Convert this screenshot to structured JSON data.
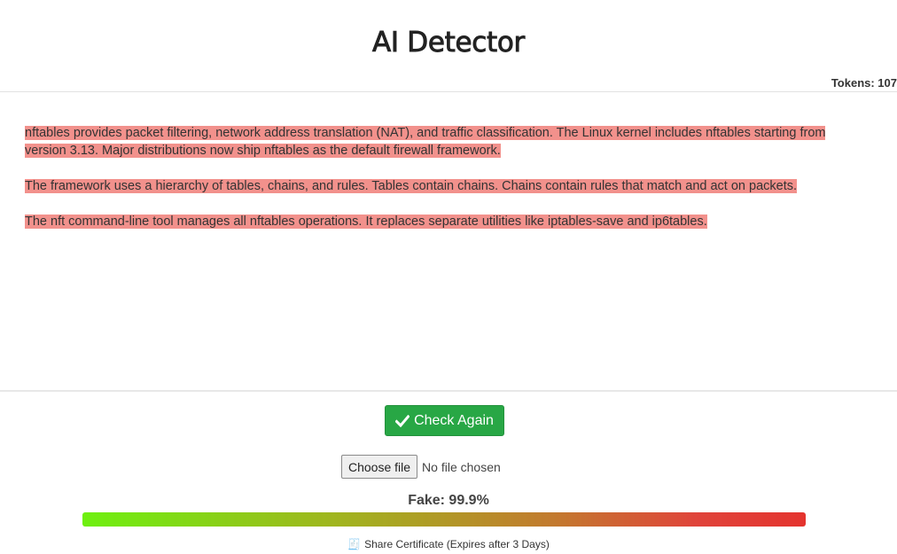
{
  "header": {
    "title": "AI Detector",
    "tokens_label": "Tokens: 107"
  },
  "content": {
    "paragraphs": [
      "nftables provides packet filtering, network address translation (NAT), and traffic classification. The Linux kernel includes nftables starting from version 3.13. Major distributions now ship nftables as the default firewall framework.",
      "The framework uses a hierarchy of tables, chains, and rules. Tables contain chains. Chains contain rules that match and act on packets.",
      "The nft command-line tool manages all nftables operations. It replaces separate utilities like iptables-save and ip6tables."
    ],
    "highlight_color": "#f2918c"
  },
  "actions": {
    "check_again_label": "Check Again",
    "check_icon": "check-icon",
    "choose_file_label": "Choose file",
    "file_status": "No file chosen"
  },
  "result": {
    "fake_label": "Fake: 99.9%",
    "fake_fraction": 0.999,
    "share_label": "Share Certificate (Expires after 3 Days)",
    "share_icon": "receipt-icon"
  },
  "colors": {
    "button_green": "#28a745",
    "meter_start": "#6ef00f",
    "meter_end": "#e4332e"
  }
}
